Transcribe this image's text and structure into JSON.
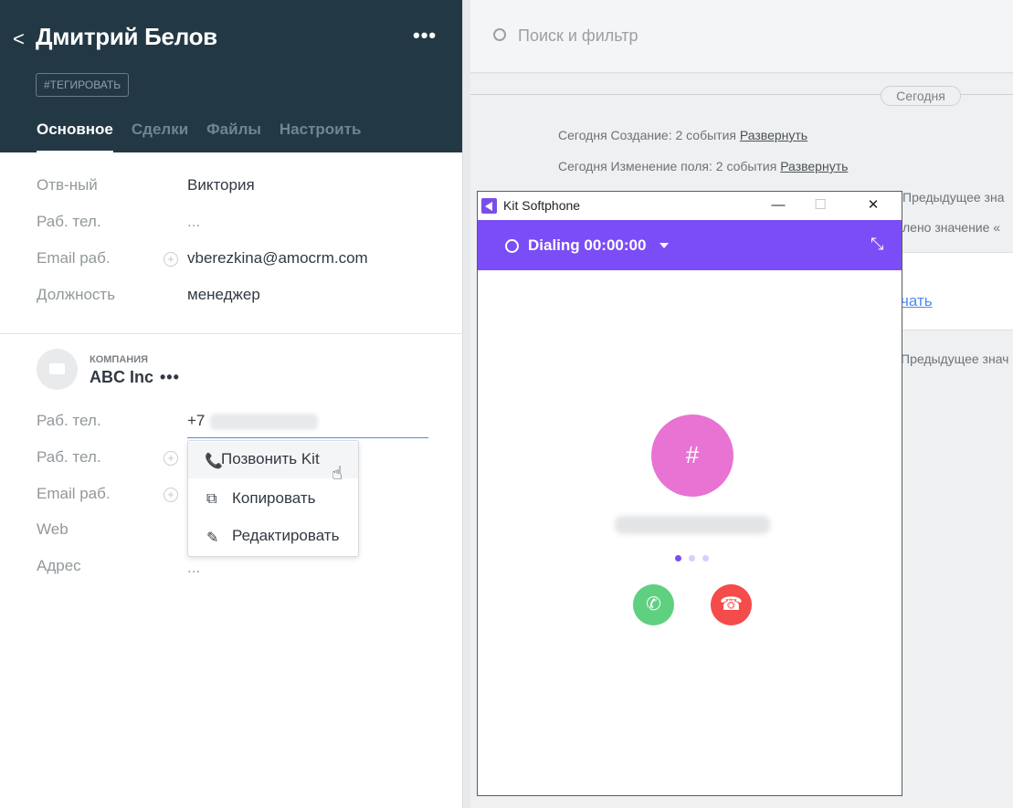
{
  "contact": {
    "name": "Дмитрий Белов",
    "back": "<",
    "more": "•••",
    "tag_button": "#ТЕГИРОВАТЬ",
    "tabs": [
      "Основное",
      "Сделки",
      "Файлы",
      "Настроить"
    ],
    "fields": [
      {
        "label": "Отв-ный",
        "value": "Виктория"
      },
      {
        "label": "Раб. тел.",
        "value": "..."
      },
      {
        "label": "Email раб.",
        "value": "vberezkina@amocrm.com"
      },
      {
        "label": "Должность",
        "value": "менеджер"
      }
    ]
  },
  "company": {
    "kicker": "КОМПАНИЯ",
    "name": "ABC Inc",
    "more": "•••",
    "fields": [
      {
        "label": "Раб. тел.",
        "value": "+7"
      },
      {
        "label": "Раб. тел.",
        "value": ""
      },
      {
        "label": "Email раб.",
        "value": ""
      },
      {
        "label": "Web",
        "value": ""
      },
      {
        "label": "Адрес",
        "value": "..."
      }
    ]
  },
  "context_menu": {
    "items": [
      "Позвонить Kit",
      "Копировать",
      "Редактировать"
    ]
  },
  "feed": {
    "search_placeholder": "Поиск и фильтр",
    "today": "Сегодня",
    "row1_text": "Сегодня Создание: 2 события",
    "row1_link": "Развернуть",
    "row2_text": "Сегодня Изменение поля: 2 события",
    "row2_link": "Развернуть",
    "row3_text": "Предыдущее зна",
    "row4_text": "лено значение «",
    "row5_link": "чать",
    "row6_text": "Предыдущее знач"
  },
  "softphone": {
    "title": "Kit Softphone",
    "status": "Dialing 00:00:00",
    "avatar": "#",
    "window_min": "—",
    "window_max": "☐",
    "window_close": "✕"
  },
  "colors": {
    "header_bg": "#233845",
    "softphone_accent": "#7b4df6",
    "avatar": "#e873d3",
    "accept": "#5fd080",
    "decline": "#f54b4b"
  }
}
